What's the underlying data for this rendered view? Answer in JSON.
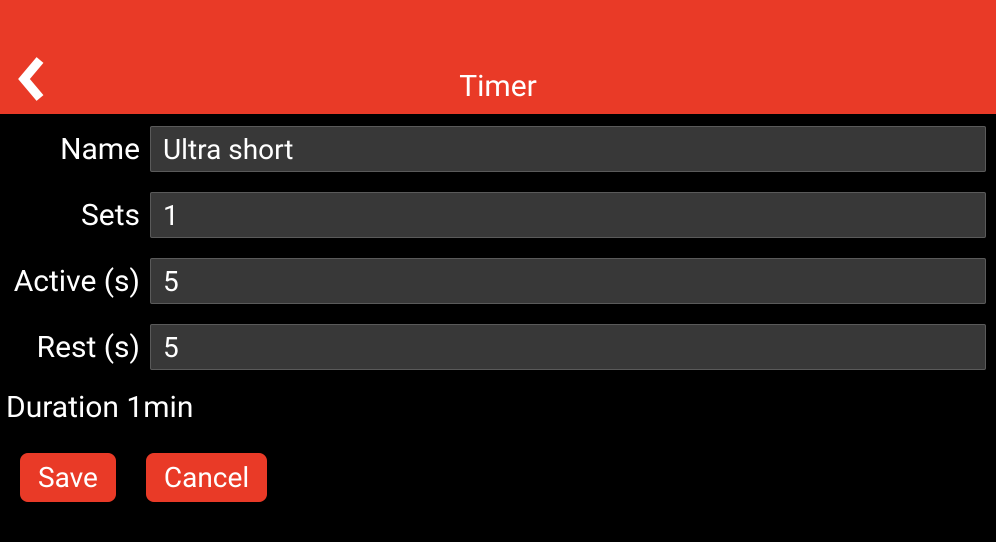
{
  "header": {
    "title": "Timer"
  },
  "form": {
    "name": {
      "label": "Name",
      "value": "Ultra short"
    },
    "sets": {
      "label": "Sets",
      "value": "1"
    },
    "active": {
      "label": "Active (s)",
      "value": "5"
    },
    "rest": {
      "label": "Rest (s)",
      "value": "5"
    }
  },
  "duration": {
    "text": "Duration 1min"
  },
  "buttons": {
    "save": "Save",
    "cancel": "Cancel"
  },
  "colors": {
    "accent": "#e93a27",
    "input_bg": "#383838",
    "background": "#000000"
  }
}
